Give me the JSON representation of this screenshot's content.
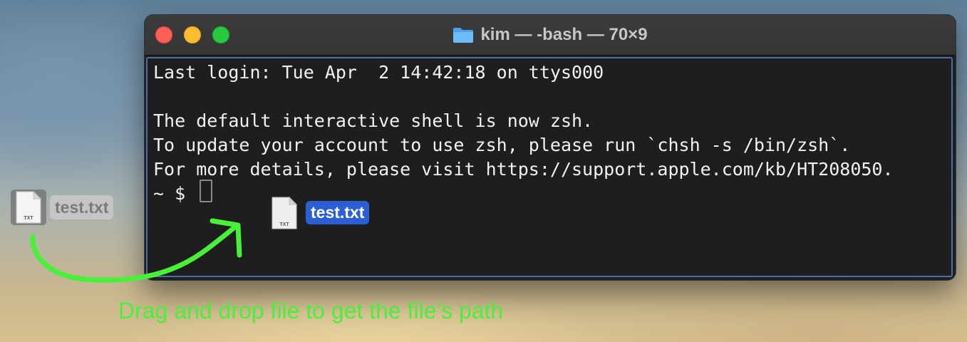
{
  "window": {
    "title": "kim — -bash — 70×9",
    "title_icon": "folder-icon",
    "traffic_lights": {
      "close": "#fe5f57",
      "minimize": "#febc2e",
      "zoom": "#28c840"
    }
  },
  "terminal": {
    "lines": [
      "Last login: Tue Apr  2 14:42:18 on ttys000",
      "",
      "The default interactive shell is now zsh.",
      "To update your account to use zsh, please run `chsh -s /bin/zsh`.",
      "For more details, please visit https://support.apple.com/kb/HT208050.",
      "~ $ "
    ]
  },
  "desktop_file": {
    "name": "test.txt",
    "badge": "TXT"
  },
  "dragged_file": {
    "name": "test.txt",
    "badge": "TXT",
    "highlight_color": "#2c5fd4"
  },
  "annotation": {
    "caption": "Drag and drop file to get the file’s path",
    "color": "#48f03a"
  }
}
